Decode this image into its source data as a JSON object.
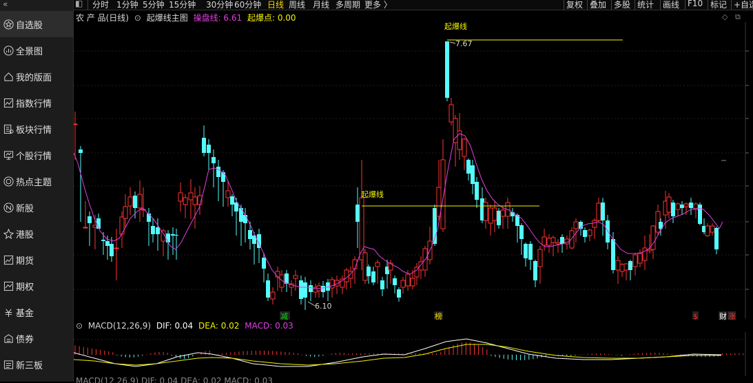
{
  "sidebar": {
    "collapse_glyph": "«",
    "items": [
      {
        "label": "自选股",
        "icon": "star-icon",
        "active": true
      },
      {
        "label": "全景图",
        "icon": "globe-icon"
      },
      {
        "label": "我的版面",
        "icon": "home-icon"
      },
      {
        "label": "指数行情",
        "icon": "line-chart-icon"
      },
      {
        "label": "板块行情",
        "icon": "blocks-icon"
      },
      {
        "label": "个股行情",
        "icon": "monitor-icon"
      },
      {
        "label": "热点主题",
        "icon": "target-icon"
      },
      {
        "label": "新股",
        "icon": "new-stock-icon"
      },
      {
        "label": "港股",
        "icon": "hk-icon"
      },
      {
        "label": "期货",
        "icon": "futures-icon"
      },
      {
        "label": "期权",
        "icon": "options-icon"
      },
      {
        "label": "基金",
        "icon": "fund-icon"
      },
      {
        "label": "债券",
        "icon": "bond-icon"
      },
      {
        "label": "新三板",
        "icon": "board-icon"
      }
    ]
  },
  "toolbar": {
    "periods": [
      "分时",
      "1分钟",
      "5分钟",
      "15分钟",
      "30分钟",
      "60分钟",
      "日线",
      "周线",
      "月线",
      "多周期",
      "更多 〉"
    ],
    "selected_period": "日线",
    "right_buttons": [
      "复权",
      "叠加",
      "多股",
      "统计",
      "画线",
      "F10",
      "标记",
      "+自选"
    ]
  },
  "info": {
    "stock_name": "农 产 品(日线)",
    "indicator": "起爆线主图",
    "op_label": "操盘线: 6.61",
    "burst_label": "起爆点: 0.00"
  },
  "macd": {
    "label": "MACD(12,26,9)",
    "dif": "DIF: 0.04",
    "dea": "DEA: 0.02",
    "macd": "MACD: 0.03",
    "second_label": "MACD(12,26,9)  DIF: 0.04  DEA: 0.02  MACD: 0.03"
  },
  "chart_data": {
    "type": "candlestick",
    "high_label": "7.67",
    "low_label": "6.10",
    "line_labels": [
      "起爆线",
      "起爆线"
    ],
    "markers": [
      {
        "text": "减",
        "color": "#00e000"
      },
      {
        "text": "榜",
        "color": "#f4d900"
      },
      {
        "text": "$",
        "color": "#ff2a2a"
      },
      {
        "text": "财",
        "color": "#ffffff"
      },
      {
        "text": "涨",
        "color": "#ff2a2a"
      }
    ],
    "colors": {
      "up": "#ff3333",
      "down": "#54fcfc",
      "ma": "#e040e0",
      "dif": "#ffffff",
      "dea": "#f4f400"
    }
  }
}
